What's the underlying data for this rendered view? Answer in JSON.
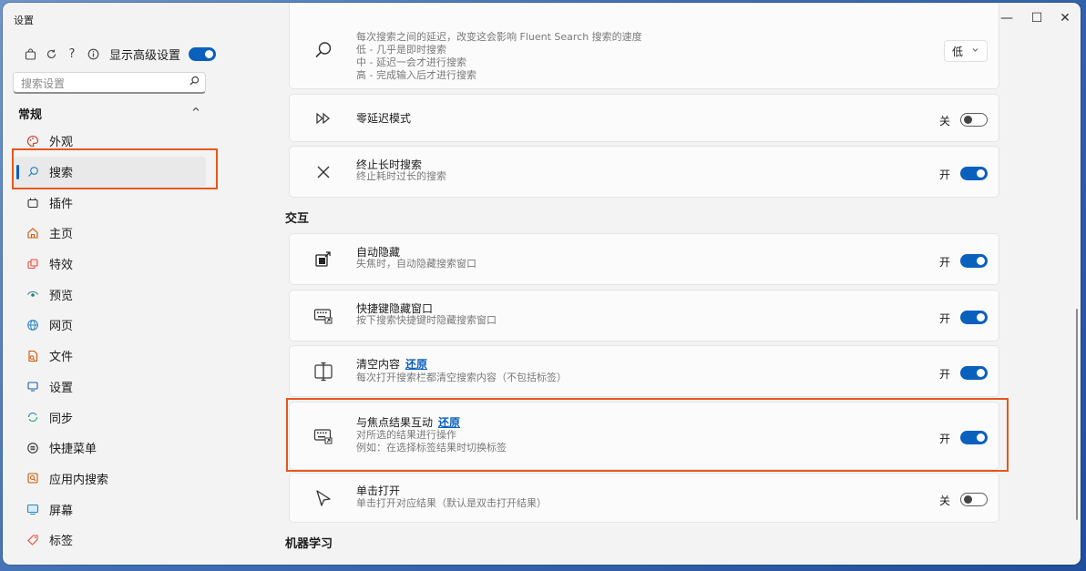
{
  "window": {
    "title": "设置",
    "minimize": "—",
    "maximize": "☐",
    "close": "✕"
  },
  "sidebar": {
    "advanced_label": "显示高级设置",
    "advanced_on": true,
    "search_placeholder": "搜索设置",
    "section_label": "常规",
    "items": [
      {
        "label": "外观",
        "icon": "palette-icon"
      },
      {
        "label": "搜索",
        "icon": "search-icon",
        "active": true
      },
      {
        "label": "插件",
        "icon": "plugin-icon"
      },
      {
        "label": "主页",
        "icon": "home-icon"
      },
      {
        "label": "特效",
        "icon": "effects-icon"
      },
      {
        "label": "预览",
        "icon": "eye-icon"
      },
      {
        "label": "网页",
        "icon": "globe-icon"
      },
      {
        "label": "文件",
        "icon": "file-icon"
      },
      {
        "label": "设置",
        "icon": "monitor-icon"
      },
      {
        "label": "同步",
        "icon": "sync-icon"
      },
      {
        "label": "快捷菜单",
        "icon": "menu-icon"
      },
      {
        "label": "应用内搜索",
        "icon": "in-app-search-icon"
      },
      {
        "label": "屏幕",
        "icon": "screen-icon"
      },
      {
        "label": "标签",
        "icon": "tag-icon"
      }
    ]
  },
  "main": {
    "delay": {
      "desc_lines": [
        "每次搜索之间的延迟，改变这会影响 Fluent Search 搜索的速度",
        "低 - 几乎是即时搜索",
        "中 - 延迟一会才进行搜索",
        "高 - 完成输入后才进行搜索"
      ],
      "value": "低"
    },
    "zero_delay": {
      "title": "零延迟模式",
      "state": "关",
      "on": false
    },
    "stop_long": {
      "title": "终止长时搜索",
      "desc": "终止耗时过长的搜索",
      "state": "开",
      "on": true
    },
    "group_interaction": "交互",
    "auto_hide": {
      "title": "自动隐藏",
      "desc": "失焦时，自动隐藏搜索窗口",
      "state": "开",
      "on": true
    },
    "hotkey_hide": {
      "title": "快捷键隐藏窗口",
      "desc": "按下搜索快捷键时隐藏搜索窗口",
      "state": "开",
      "on": true
    },
    "clear_content": {
      "title": "清空内容",
      "link": "还原",
      "desc": "每次打开搜索栏都清空搜索内容（不包括标签）",
      "state": "开",
      "on": true
    },
    "focus_interact": {
      "title": "与焦点结果互动",
      "link": "还原",
      "desc_lines": [
        "对所选的结果进行操作",
        "例如：在选择标签结果时切换标签"
      ],
      "state": "开",
      "on": true
    },
    "single_click": {
      "title": "单击打开",
      "desc": "单击打开对应结果（默认是双击打开结果）",
      "state": "关",
      "on": false
    },
    "group_ml": "机器学习"
  },
  "colors": {
    "accent": "#0a60bd",
    "highlight": "#e8561c"
  }
}
